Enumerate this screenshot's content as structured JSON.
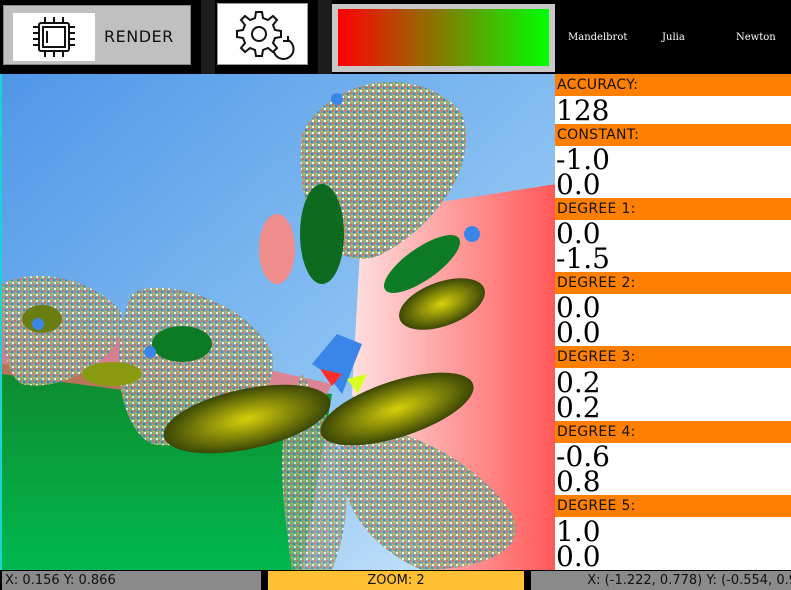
{
  "toolbar": {
    "render_label": "RENDER",
    "render_icon": "chip-icon",
    "settings_icon": "gear-refresh-icon"
  },
  "color_gradient": {
    "start": "#ff0000",
    "end": "#00ff00"
  },
  "fractal_types": [
    {
      "label": "Mandelbrot"
    },
    {
      "label": "Julia"
    },
    {
      "label": "Newton"
    }
  ],
  "params": {
    "accuracy": {
      "label": "ACCURACY:",
      "values": [
        "128"
      ]
    },
    "constant": {
      "label": "CONSTANT:",
      "values": [
        "-1.0",
        "0.0"
      ]
    },
    "degree1": {
      "label": "DEGREE 1:",
      "values": [
        "0.0",
        "-1.5"
      ]
    },
    "degree2": {
      "label": "DEGREE 2:",
      "values": [
        "0.0",
        "0.0"
      ]
    },
    "degree3": {
      "label": "DEGREE 3:",
      "values": [
        "0.2",
        "0.2"
      ]
    },
    "degree4": {
      "label": "DEGREE 4:",
      "values": [
        "-0.6",
        "0.8"
      ]
    },
    "degree5": {
      "label": "DEGREE 5:",
      "values": [
        "1.0",
        "0.0"
      ]
    }
  },
  "status": {
    "coords": "X: 0.156 Y: 0.866",
    "zoom": "ZOOM: 2",
    "bounds": "X: (-1.222, 0.778) Y: (-0.554, 0.9"
  },
  "colors": {
    "accent_orange": "#ff8000",
    "zoom_yellow": "#ffc033",
    "canvas_border": "#19d4d4"
  }
}
